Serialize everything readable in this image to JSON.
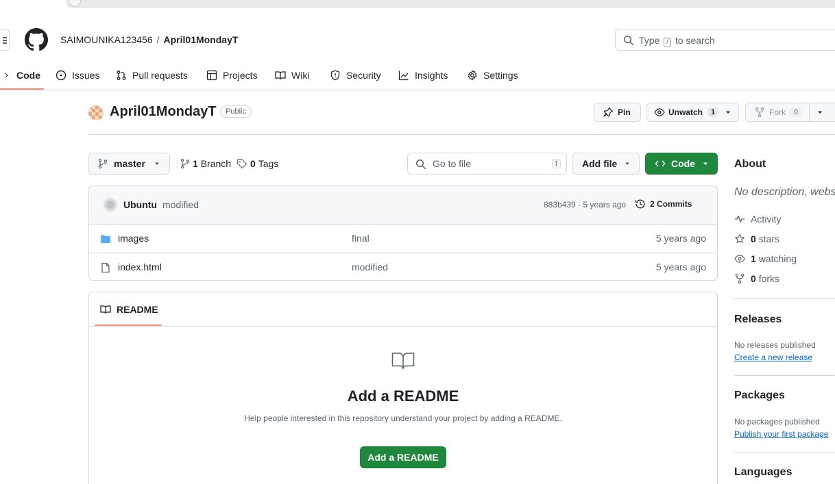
{
  "header": {
    "owner": "SAIMOUNIKA123456",
    "separator": "/",
    "repo": "April01MondayT",
    "search_prefix": "Type",
    "search_key": "/",
    "search_suffix": "to search"
  },
  "nav": {
    "tabs": [
      {
        "label": "Code",
        "icon": "code-icon",
        "active": true
      },
      {
        "label": "Issues",
        "icon": "issue-icon"
      },
      {
        "label": "Pull requests",
        "icon": "pull-request-icon"
      },
      {
        "label": "Projects",
        "icon": "table-icon"
      },
      {
        "label": "Wiki",
        "icon": "book-icon"
      },
      {
        "label": "Security",
        "icon": "shield-icon"
      },
      {
        "label": "Insights",
        "icon": "graph-icon"
      },
      {
        "label": "Settings",
        "icon": "gear-icon"
      }
    ]
  },
  "repo_header": {
    "name": "April01MondayT",
    "visibility": "Public",
    "pin_label": "Pin",
    "unwatch_label": "Unwatch",
    "watch_count": "1",
    "fork_label": "Fork",
    "fork_count": "0"
  },
  "toolbar": {
    "branch": "master",
    "branch_count": "1",
    "branch_label": "Branch",
    "tag_count": "0",
    "tag_label": "Tags",
    "go_to_file_placeholder": "Go to file",
    "go_to_file_key": "t",
    "add_file_label": "Add file",
    "code_label": "Code"
  },
  "commit": {
    "author": "Ubuntu",
    "message": "modified",
    "hash_time": "883b439 · 5 years ago",
    "commits_count": "2",
    "commits_label": "Commits"
  },
  "files": [
    {
      "name": "images",
      "type": "folder",
      "message": "final",
      "time": "5 years ago"
    },
    {
      "name": "index.html",
      "type": "file",
      "message": "modified",
      "time": "5 years ago"
    }
  ],
  "readme": {
    "tab_label": "README",
    "heading": "Add a README",
    "description": "Help people interested in this repository understand your project by adding a README.",
    "button_label": "Add a README"
  },
  "sidebar": {
    "about_title": "About",
    "about_text": "No description, website",
    "activity_label": "Activity",
    "stars_count": "0",
    "stars_label": "stars",
    "watching_count": "1",
    "watching_label": "watching",
    "forks_count": "0",
    "forks_label": "forks",
    "releases_title": "Releases",
    "releases_text": "No releases published",
    "releases_link": "Create a new release",
    "packages_title": "Packages",
    "packages_text": "No packages published",
    "packages_link": "Publish your first package",
    "languages_title": "Languages"
  },
  "colors": {
    "accent_green": "#1f883d",
    "link_blue": "#0969da",
    "nav_underline": "#fd8c73",
    "muted_text": "#59636e"
  }
}
